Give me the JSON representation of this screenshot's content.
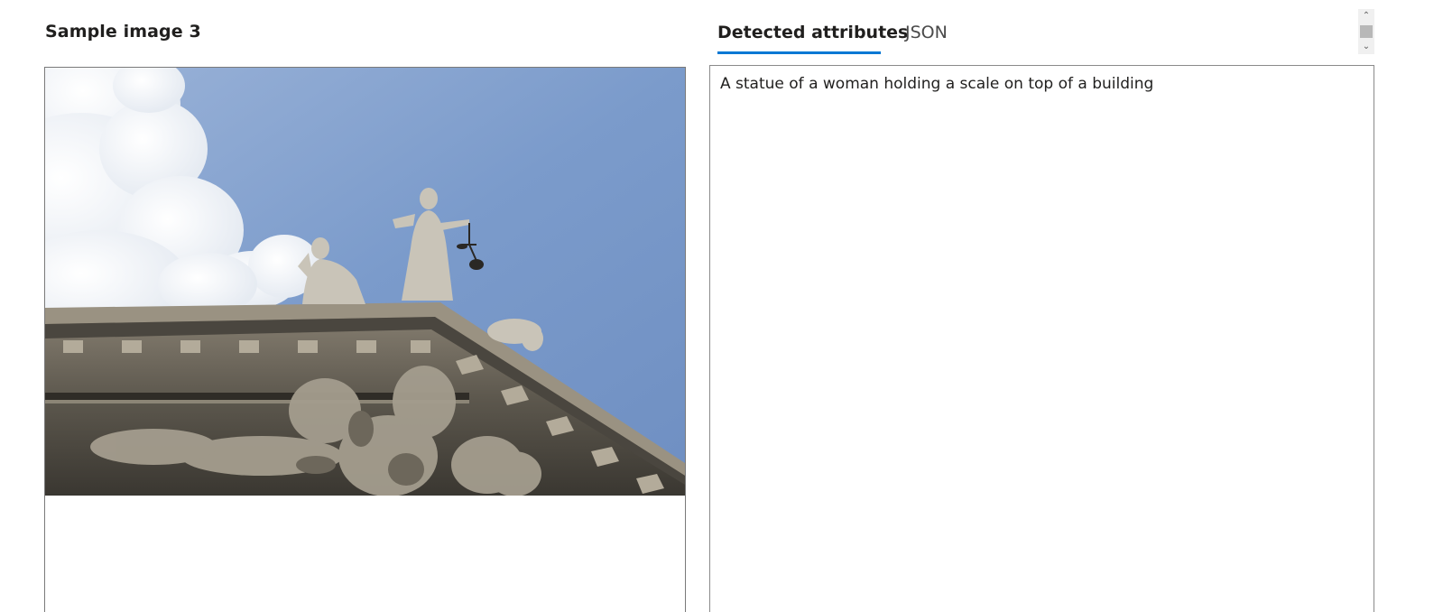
{
  "left_panel": {
    "title": "Sample image 3"
  },
  "tabs": [
    {
      "label": "Detected attributes",
      "active": true
    },
    {
      "label": "JSON",
      "active": false
    }
  ],
  "result": {
    "caption": "A statue of a woman holding a scale on top of a building"
  },
  "colors": {
    "accent": "#0078d4",
    "border": "#7a7a7a",
    "sky": "#7898c7"
  },
  "icons": {
    "scroll_up": "chevron-up-icon",
    "scroll_down": "chevron-down-icon"
  }
}
